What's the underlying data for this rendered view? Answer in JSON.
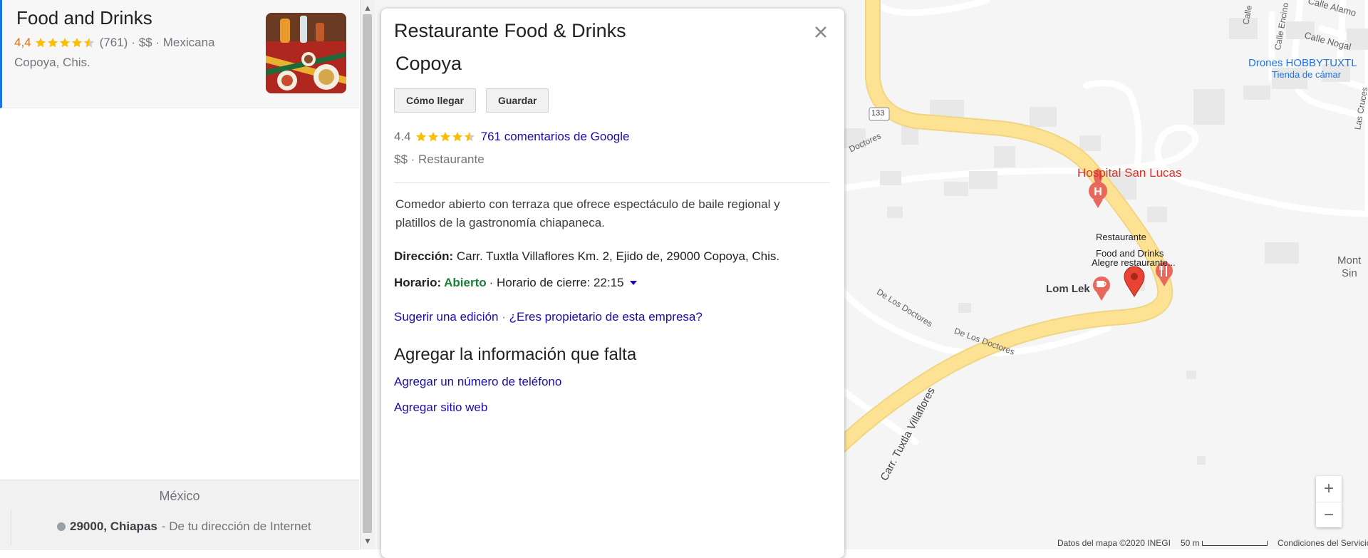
{
  "result": {
    "title": "Food and Drinks",
    "rating": "4,4",
    "reviews": "(761)",
    "meta": "· $$ · Mexicana",
    "location": "Copoya, Chis."
  },
  "footer": {
    "country": "México",
    "location_bold": "29000, Chiapas",
    "location_rest": "- De tu dirección de Internet"
  },
  "card": {
    "title": "Restaurante Food & Drinks",
    "subtitle": "Copoya",
    "buttons": {
      "directions": "Cómo llegar",
      "save": "Guardar"
    },
    "rating": "4.4",
    "reviews_link": "761 comentarios de Google",
    "price": "$$",
    "category": "Restaurante",
    "description": "Comedor abierto con terraza que ofrece espectáculo de baile regional y platillos de la gastronomía chiapaneca.",
    "address_label": "Dirección:",
    "address": "Carr. Tuxtla Villaflores Km. 2, Ejido de, 29000 Copoya, Chis.",
    "hours_label": "Horario:",
    "hours_status": "Abierto",
    "hours_close": "· Horario de cierre: 22:15",
    "suggest_edit": "Sugerir una edición",
    "owner_link": "¿Eres propietario de esta empresa?",
    "missing_heading": "Agregar la información que falta",
    "add_phone": "Agregar un número de teléfono",
    "add_website": "Agregar sitio web"
  },
  "map": {
    "labels": {
      "hospital": "Hospital San Lucas",
      "restaurant_line1": "Restaurante",
      "restaurant_line2": "Food and Drinks",
      "restaurant_line3": "Alegre restaurante...",
      "lom_lek": "Lom Lek",
      "drones": "Drones HOBBYTUXTL",
      "drones_sub": "Tienda de cámar",
      "monte": "Mont",
      "monte2": "Sin",
      "calle_alamo": "Calle Alamo",
      "calle_nogal": "Calle Nogal",
      "calle_encino": "Calle Encino",
      "calle": "Calle",
      "las_cruces": "Las Cruces",
      "doctores": "Doctores",
      "de_los_doctores_1": "De Los Doctores",
      "de_los_doctores_2": "De Los Doctores",
      "carretera": "Carr. Tuxtla Villaflores",
      "route": "133"
    },
    "zoom_in": "+",
    "zoom_out": "−",
    "attribution": "Datos del mapa ©2020 INEGI",
    "scale": "50 m",
    "terms": "Condiciones del Servicio",
    "road_color": "#fde293",
    "pin_color": "#ea4335"
  }
}
